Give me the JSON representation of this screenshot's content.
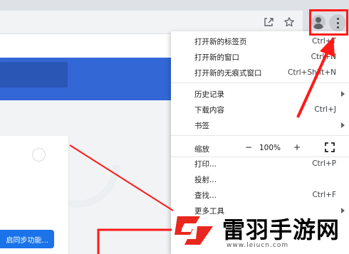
{
  "menu": {
    "new_tab": {
      "label": "打开新的标签页",
      "shortcut": "Ctrl+T"
    },
    "new_window": {
      "label": "打开新的窗口",
      "shortcut": "Ctrl+N"
    },
    "new_incognito": {
      "label": "打开新的无痕式窗口",
      "shortcut": "Ctrl+Shift+N"
    },
    "history": {
      "label": "历史记录"
    },
    "downloads": {
      "label": "下载内容",
      "shortcut": "Ctrl+J"
    },
    "bookmarks": {
      "label": "书签"
    },
    "zoom": {
      "label": "缩放",
      "minus": "−",
      "value": "100%",
      "plus": "+"
    },
    "print": {
      "label": "打印...",
      "shortcut": "Ctrl+P"
    },
    "cast": {
      "label": "投射..."
    },
    "find": {
      "label": "查找...",
      "shortcut": "Ctrl+F"
    },
    "more_tools": {
      "label": "更多工具"
    }
  },
  "page": {
    "sync_button": "启同步功能..."
  },
  "watermark": {
    "title": "雷羽手游网",
    "url": "www.leiucn.com"
  },
  "colors": {
    "accent_blue": "#3367d6",
    "button_blue": "#1a73e8",
    "annotation_red": "#ff1a1a",
    "logo_red": "#e8281e"
  },
  "icons": [
    "share-icon",
    "star-icon",
    "profile-icon",
    "kebab-menu-icon",
    "fullscreen-icon",
    "submenu-arrow-icon"
  ]
}
